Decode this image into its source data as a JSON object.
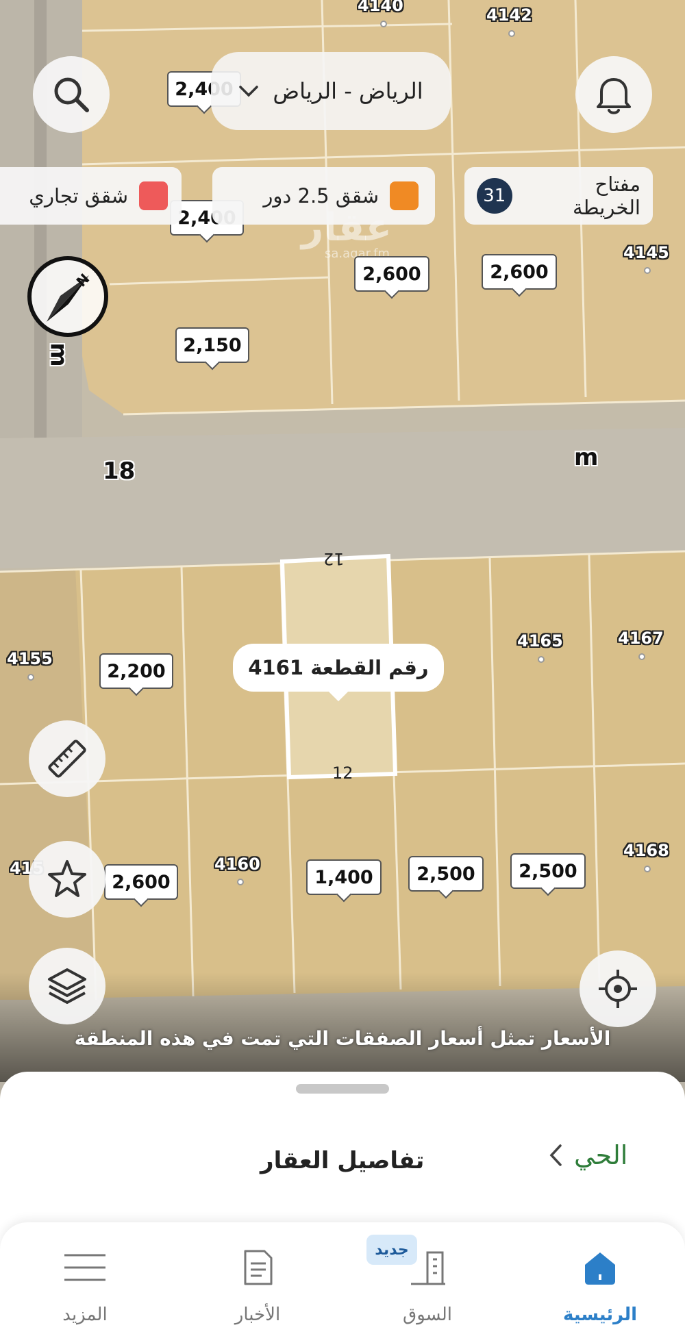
{
  "header": {
    "city_selector": "الرياض - الرياض",
    "chevron_icon": "chevron-down-icon",
    "search_icon": "search-icon",
    "bell_icon": "bell-icon"
  },
  "legend": {
    "map_key_label": "مفتاح الخريطة",
    "map_key_count": "31",
    "items": [
      {
        "label": "شقق 2.5 دور",
        "color": "#f08a24"
      },
      {
        "label": "شقق تجاري",
        "color": "#ee5a5a"
      }
    ]
  },
  "watermark": {
    "brand": "عقار",
    "site": "sa.aqar.fm"
  },
  "map": {
    "plot_numbers": [
      "4140",
      "4142",
      "4145",
      "4155",
      "4165",
      "4167",
      "4160",
      "4168",
      "415"
    ],
    "street_labels": {
      "s1": "18",
      "s2": "m",
      "s3": "m"
    },
    "plot_edge_labels": {
      "top": "12",
      "bottom": "12"
    },
    "prices": [
      "2,400",
      "2,400",
      "2,600",
      "2,600",
      "2,150",
      "2,200",
      "2,600",
      "1,400",
      "2,500",
      "2,500"
    ],
    "selected_plot_popup": "رقم القطعة 4161"
  },
  "note": "الأسعار تمثل أسعار الصفقات التي تمت في هذه المنطقة",
  "sheet": {
    "title": "تفاصيل العقار",
    "neighborhood_link": "الحي"
  },
  "tabs": [
    {
      "label": "الرئيسية",
      "icon": "home-icon",
      "active": true
    },
    {
      "label": "السوق",
      "icon": "buildings-icon",
      "badge": "جديد"
    },
    {
      "label": "الأخبار",
      "icon": "news-icon"
    },
    {
      "label": "المزيد",
      "icon": "menu-icon"
    }
  ],
  "colors": {
    "accent": "#2c7fc8",
    "link_green": "#2f7d3a",
    "plot_sand": "#dcc392",
    "road_grey": "#bdb6a6"
  }
}
